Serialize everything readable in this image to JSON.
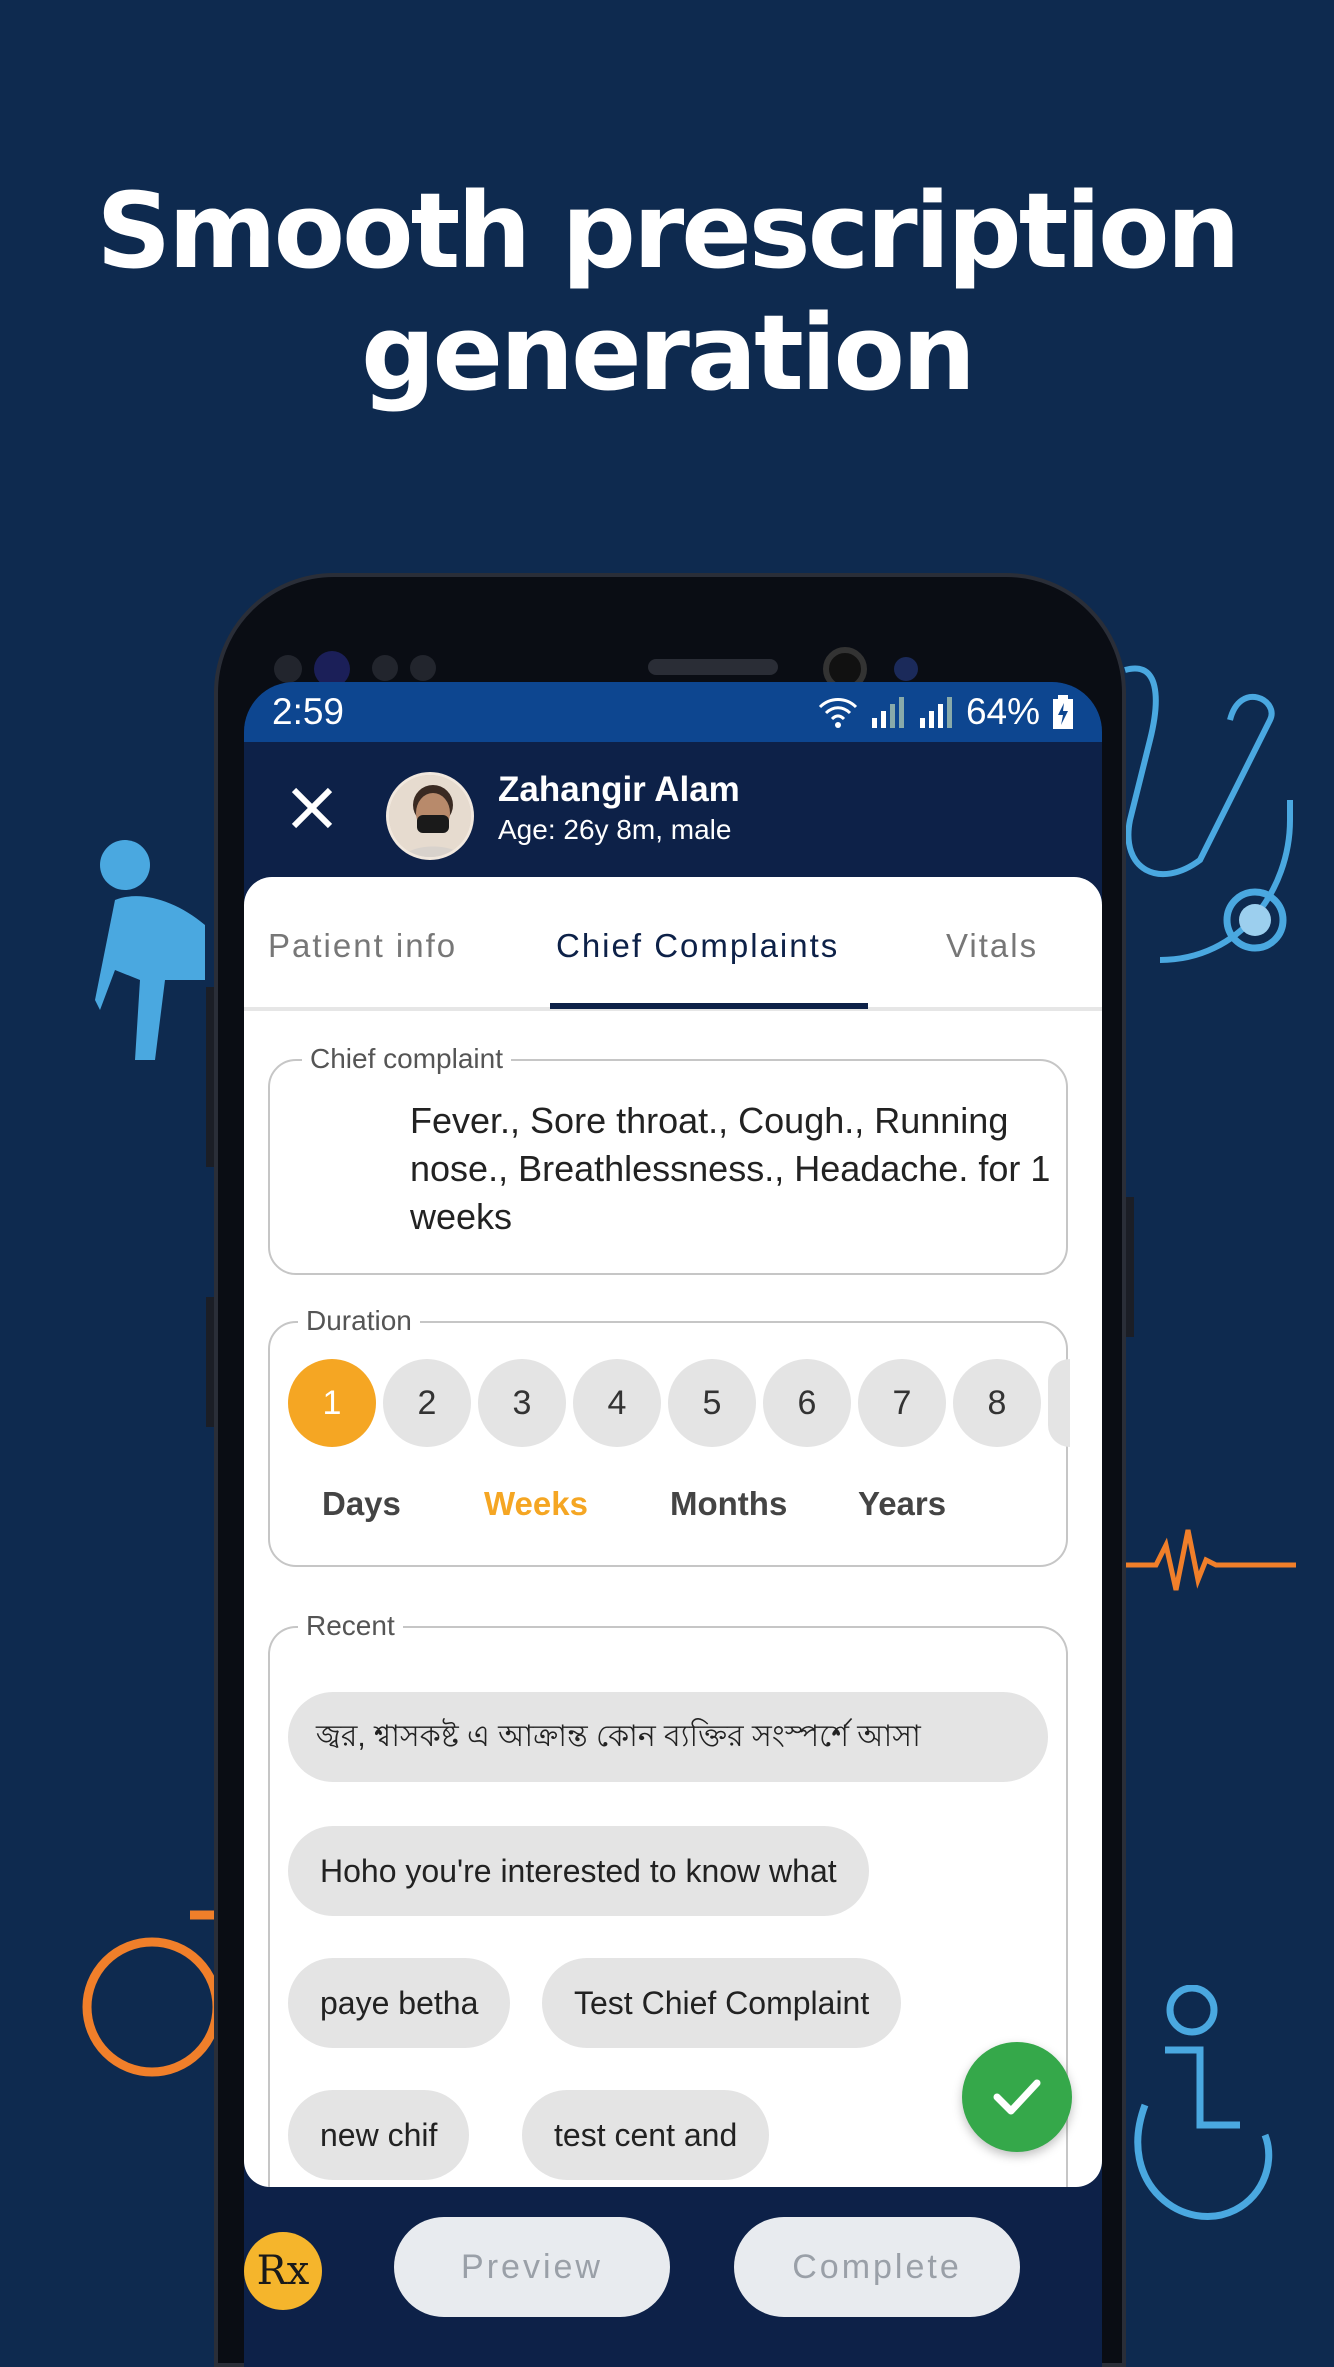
{
  "headline": {
    "line1": "Smooth prescription",
    "line2": "generation"
  },
  "statusbar": {
    "time": "2:59",
    "battery": "64%"
  },
  "patient": {
    "name": "Zahangir Alam",
    "meta": "Age: 26y 8m, male"
  },
  "tabs": [
    {
      "label": "Patient info",
      "active": false
    },
    {
      "label": "Chief Complaints",
      "active": true
    },
    {
      "label": "Vitals",
      "active": false
    }
  ],
  "chief_complaint": {
    "legend": "Chief complaint",
    "text": "Fever., Sore throat., Cough., Running nose., Breathlessness., Headache. for 1 weeks"
  },
  "duration": {
    "legend": "Duration",
    "numbers": [
      "1",
      "2",
      "3",
      "4",
      "5",
      "6",
      "7",
      "8"
    ],
    "selected_number": "1",
    "units": [
      "Days",
      "Weeks",
      "Months",
      "Years"
    ],
    "selected_unit": "Weeks"
  },
  "recent": {
    "legend": "Recent",
    "chips": [
      "জ্বর, শ্বাসকষ্ট এ আক্রান্ত কোন ব্যক্তির সংস্পর্শে আসা",
      "Hoho you're interested to know what",
      "paye betha",
      "Test Chief Complaint",
      "new chif",
      "test cent and"
    ]
  },
  "bottom": {
    "rx_label": "Rx",
    "preview_label": "Preview",
    "complete_label": "Complete"
  },
  "colors": {
    "background": "#0e2a4f",
    "accent": "#f5a623",
    "fab": "#35a84a",
    "appbar": "#0d2148"
  }
}
